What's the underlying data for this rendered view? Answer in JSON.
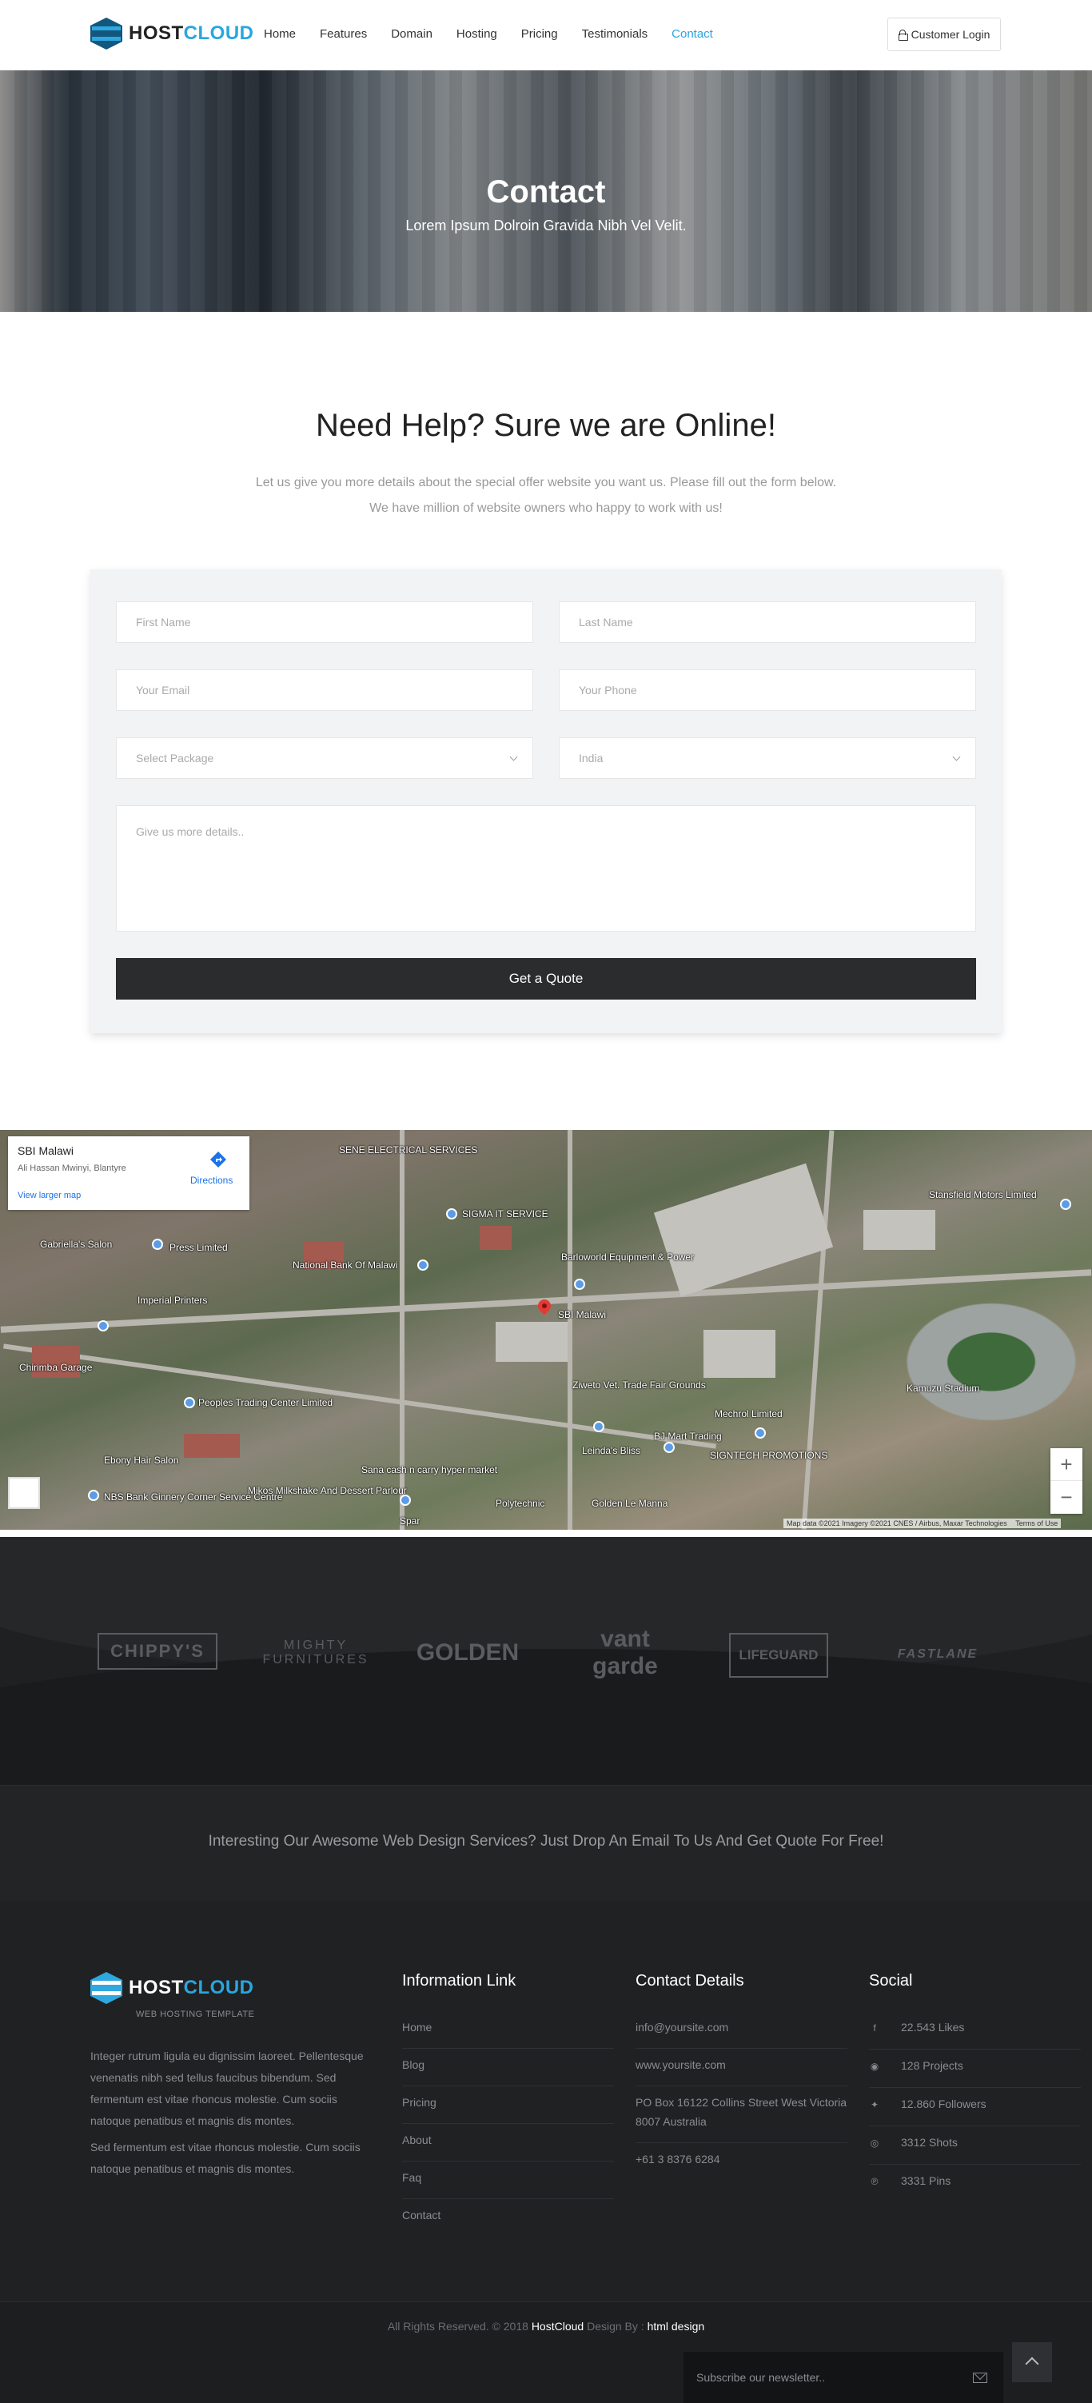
{
  "header": {
    "logo": {
      "host": "HOST",
      "cloud": "CLOUD"
    },
    "nav": [
      "Home",
      "Features",
      "Domain",
      "Hosting",
      "Pricing",
      "Testimonials",
      "Contact"
    ],
    "active_nav": "Contact",
    "login_label": "Customer Login"
  },
  "hero": {
    "title": "Contact",
    "subtitle": "Lorem Ipsum Dolroin Gravida Nibh Vel Velit."
  },
  "help": {
    "title": "Need Help? Sure we are Online!",
    "line1": "Let us give you more details about the special offer website you want us. Please fill out the form below.",
    "line2": "We have million of website owners who happy to work with us!"
  },
  "form": {
    "first_name": "First Name",
    "last_name": "Last Name",
    "email": "Your Email",
    "phone": "Your Phone",
    "package": "Select Package",
    "country": "India",
    "details": "Give us more details..",
    "submit": "Get a Quote"
  },
  "map": {
    "place_title": "SBI Malawi",
    "place_address": "Ali Hassan Mwinyi, Blantyre",
    "larger_map": "View larger map",
    "directions": "Directions",
    "labels": [
      "SENE ELECTRICAL SERVICES",
      "SIGMA IT SERVICE",
      "Press Limited",
      "Gabriella's Salon",
      "National Bank Of Malawi",
      "Imperial Printers",
      "Barloworld Equipment & Power",
      "SBI Malawi",
      "Stansfield Motors Limited",
      "Chirimba Garage",
      "Peoples Trading Center Limited",
      "Ziweto Vet. Trade Fair Grounds",
      "Mechrol Limited",
      "Kamuzu Stadium",
      "Ebony Hair Salon",
      "Sana cash n carry hyper market",
      "BJ Mart Trading",
      "Leinda's Bliss",
      "SIGNTECH PROMOTIONS",
      "NBS Bank Ginnery Corner Service Centre",
      "Mikos Milkshake And Dessert Parlour",
      "Polytechnic",
      "Golden Le Manna",
      "Spar"
    ],
    "attribution": "Map data ©2021 Imagery ©2021 CNES / Airbus, Maxar Technologies",
    "terms": "Terms of Use",
    "zoom_in": "+",
    "zoom_out": "−"
  },
  "partners": [
    "CHIPPY'S",
    "MIGHTY FURNITURES",
    "GOLDEN",
    "vant garde",
    "LIFEGUARD",
    "FASTLANE"
  ],
  "cta": {
    "text": "Interesting Our Awesome Web Design Services? Just Drop An Email To Us And Get Quote For Free!"
  },
  "footer": {
    "tagline": "WEB HOSTING TEMPLATE",
    "about1": "Integer rutrum ligula eu dignissim laoreet. Pellentesque venenatis nibh sed tellus faucibus bibendum. Sed fermentum est vitae rhoncus molestie. Cum sociis natoque penatibus et magnis dis montes.",
    "about2": "Sed fermentum est vitae rhoncus molestie. Cum sociis natoque penatibus et magnis dis montes.",
    "info_title": "Information Link",
    "info_links": [
      "Home",
      "Blog",
      "Pricing",
      "About",
      "Faq",
      "Contact"
    ],
    "contact_title": "Contact Details",
    "contact": [
      "info@yoursite.com",
      "www.yoursite.com",
      "PO Box 16122 Collins Street West Victoria 8007 Australia",
      "+61 3 8376 6284"
    ],
    "social_title": "Social",
    "social": [
      {
        "icon": "facebook-icon",
        "glyph": "f",
        "text": "22.543 Likes"
      },
      {
        "icon": "github-icon",
        "glyph": "◉",
        "text": "128 Projects"
      },
      {
        "icon": "twitter-icon",
        "glyph": "✦",
        "text": "12.860 Followers"
      },
      {
        "icon": "dribbble-icon",
        "glyph": "◎",
        "text": "3312 Shots"
      },
      {
        "icon": "pinterest-icon",
        "glyph": "℗",
        "text": "3331 Pins"
      }
    ]
  },
  "bottom": {
    "copy_prefix": "All Rights Reserved. © 2018",
    "brand": "HostCloud",
    "design_by": "Design By :",
    "designer": "html design",
    "newsletter": "Subscribe our newsletter.."
  }
}
